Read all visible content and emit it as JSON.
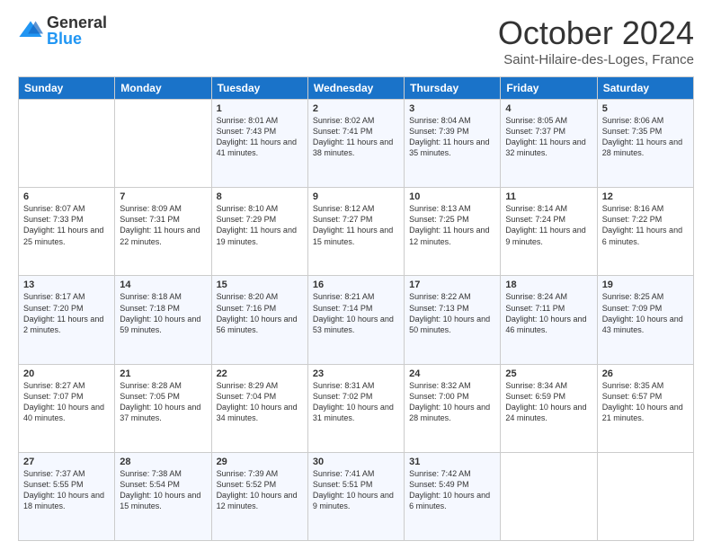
{
  "logo": {
    "general": "General",
    "blue": "Blue"
  },
  "header": {
    "month": "October 2024",
    "location": "Saint-Hilaire-des-Loges, France"
  },
  "weekdays": [
    "Sunday",
    "Monday",
    "Tuesday",
    "Wednesday",
    "Thursday",
    "Friday",
    "Saturday"
  ],
  "weeks": [
    [
      {
        "day": "",
        "info": ""
      },
      {
        "day": "",
        "info": ""
      },
      {
        "day": "1",
        "info": "Sunrise: 8:01 AM\nSunset: 7:43 PM\nDaylight: 11 hours and 41 minutes."
      },
      {
        "day": "2",
        "info": "Sunrise: 8:02 AM\nSunset: 7:41 PM\nDaylight: 11 hours and 38 minutes."
      },
      {
        "day": "3",
        "info": "Sunrise: 8:04 AM\nSunset: 7:39 PM\nDaylight: 11 hours and 35 minutes."
      },
      {
        "day": "4",
        "info": "Sunrise: 8:05 AM\nSunset: 7:37 PM\nDaylight: 11 hours and 32 minutes."
      },
      {
        "day": "5",
        "info": "Sunrise: 8:06 AM\nSunset: 7:35 PM\nDaylight: 11 hours and 28 minutes."
      }
    ],
    [
      {
        "day": "6",
        "info": "Sunrise: 8:07 AM\nSunset: 7:33 PM\nDaylight: 11 hours and 25 minutes."
      },
      {
        "day": "7",
        "info": "Sunrise: 8:09 AM\nSunset: 7:31 PM\nDaylight: 11 hours and 22 minutes."
      },
      {
        "day": "8",
        "info": "Sunrise: 8:10 AM\nSunset: 7:29 PM\nDaylight: 11 hours and 19 minutes."
      },
      {
        "day": "9",
        "info": "Sunrise: 8:12 AM\nSunset: 7:27 PM\nDaylight: 11 hours and 15 minutes."
      },
      {
        "day": "10",
        "info": "Sunrise: 8:13 AM\nSunset: 7:25 PM\nDaylight: 11 hours and 12 minutes."
      },
      {
        "day": "11",
        "info": "Sunrise: 8:14 AM\nSunset: 7:24 PM\nDaylight: 11 hours and 9 minutes."
      },
      {
        "day": "12",
        "info": "Sunrise: 8:16 AM\nSunset: 7:22 PM\nDaylight: 11 hours and 6 minutes."
      }
    ],
    [
      {
        "day": "13",
        "info": "Sunrise: 8:17 AM\nSunset: 7:20 PM\nDaylight: 11 hours and 2 minutes."
      },
      {
        "day": "14",
        "info": "Sunrise: 8:18 AM\nSunset: 7:18 PM\nDaylight: 10 hours and 59 minutes."
      },
      {
        "day": "15",
        "info": "Sunrise: 8:20 AM\nSunset: 7:16 PM\nDaylight: 10 hours and 56 minutes."
      },
      {
        "day": "16",
        "info": "Sunrise: 8:21 AM\nSunset: 7:14 PM\nDaylight: 10 hours and 53 minutes."
      },
      {
        "day": "17",
        "info": "Sunrise: 8:22 AM\nSunset: 7:13 PM\nDaylight: 10 hours and 50 minutes."
      },
      {
        "day": "18",
        "info": "Sunrise: 8:24 AM\nSunset: 7:11 PM\nDaylight: 10 hours and 46 minutes."
      },
      {
        "day": "19",
        "info": "Sunrise: 8:25 AM\nSunset: 7:09 PM\nDaylight: 10 hours and 43 minutes."
      }
    ],
    [
      {
        "day": "20",
        "info": "Sunrise: 8:27 AM\nSunset: 7:07 PM\nDaylight: 10 hours and 40 minutes."
      },
      {
        "day": "21",
        "info": "Sunrise: 8:28 AM\nSunset: 7:05 PM\nDaylight: 10 hours and 37 minutes."
      },
      {
        "day": "22",
        "info": "Sunrise: 8:29 AM\nSunset: 7:04 PM\nDaylight: 10 hours and 34 minutes."
      },
      {
        "day": "23",
        "info": "Sunrise: 8:31 AM\nSunset: 7:02 PM\nDaylight: 10 hours and 31 minutes."
      },
      {
        "day": "24",
        "info": "Sunrise: 8:32 AM\nSunset: 7:00 PM\nDaylight: 10 hours and 28 minutes."
      },
      {
        "day": "25",
        "info": "Sunrise: 8:34 AM\nSunset: 6:59 PM\nDaylight: 10 hours and 24 minutes."
      },
      {
        "day": "26",
        "info": "Sunrise: 8:35 AM\nSunset: 6:57 PM\nDaylight: 10 hours and 21 minutes."
      }
    ],
    [
      {
        "day": "27",
        "info": "Sunrise: 7:37 AM\nSunset: 5:55 PM\nDaylight: 10 hours and 18 minutes."
      },
      {
        "day": "28",
        "info": "Sunrise: 7:38 AM\nSunset: 5:54 PM\nDaylight: 10 hours and 15 minutes."
      },
      {
        "day": "29",
        "info": "Sunrise: 7:39 AM\nSunset: 5:52 PM\nDaylight: 10 hours and 12 minutes."
      },
      {
        "day": "30",
        "info": "Sunrise: 7:41 AM\nSunset: 5:51 PM\nDaylight: 10 hours and 9 minutes."
      },
      {
        "day": "31",
        "info": "Sunrise: 7:42 AM\nSunset: 5:49 PM\nDaylight: 10 hours and 6 minutes."
      },
      {
        "day": "",
        "info": ""
      },
      {
        "day": "",
        "info": ""
      }
    ]
  ]
}
